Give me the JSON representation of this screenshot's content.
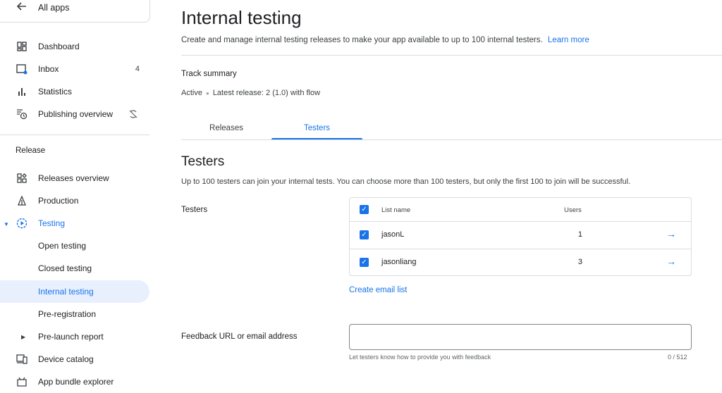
{
  "sidebar": {
    "all_apps": "All apps",
    "items": [
      {
        "label": "Dashboard",
        "icon": "dashboard-icon"
      },
      {
        "label": "Inbox",
        "icon": "inbox-icon",
        "badge": "4"
      },
      {
        "label": "Statistics",
        "icon": "statistics-icon"
      },
      {
        "label": "Publishing overview",
        "icon": "publishing-overview-icon"
      }
    ],
    "section_release": "Release",
    "release_items": [
      {
        "label": "Releases overview",
        "icon": "releases-overview-icon"
      },
      {
        "label": "Production",
        "icon": "production-icon"
      },
      {
        "label": "Testing",
        "icon": "testing-icon"
      },
      {
        "label": "Open testing"
      },
      {
        "label": "Closed testing"
      },
      {
        "label": "Internal testing"
      },
      {
        "label": "Pre-registration"
      },
      {
        "label": "Pre-launch report"
      },
      {
        "label": "Device catalog",
        "icon": "device-catalog-icon"
      },
      {
        "label": "App bundle explorer",
        "icon": "app-bundle-explorer-icon"
      }
    ]
  },
  "main": {
    "title": "Internal testing",
    "subtitle": "Create and manage internal testing releases to make your app available to up to 100 internal testers.",
    "learn_more": "Learn more",
    "track_summary": {
      "title": "Track summary",
      "status": "Active",
      "latest_release": "Latest release: 2 (1.0) with flow"
    },
    "tabs": [
      {
        "label": "Releases",
        "active": false
      },
      {
        "label": "Testers",
        "active": true
      }
    ],
    "testers_section": {
      "title": "Testers",
      "description": "Up to 100 testers can join your internal tests. You can choose more than 100 testers, but only the first 100 to join will be successful.",
      "field_label": "Testers",
      "table": {
        "columns": [
          "List name",
          "Users"
        ],
        "rows": [
          {
            "name": "jasonL",
            "users": "1",
            "checked": true
          },
          {
            "name": "jasonliang",
            "users": "3",
            "checked": true
          }
        ]
      },
      "create_email_list": "Create email list"
    },
    "feedback": {
      "label": "Feedback URL or email address",
      "value": "",
      "helper": "Let testers know how to provide you with feedback",
      "counter": "0 / 512"
    }
  },
  "colors": {
    "accent": "#1a73e8",
    "active_bg": "#e8f0fe",
    "border": "#dadce0"
  }
}
